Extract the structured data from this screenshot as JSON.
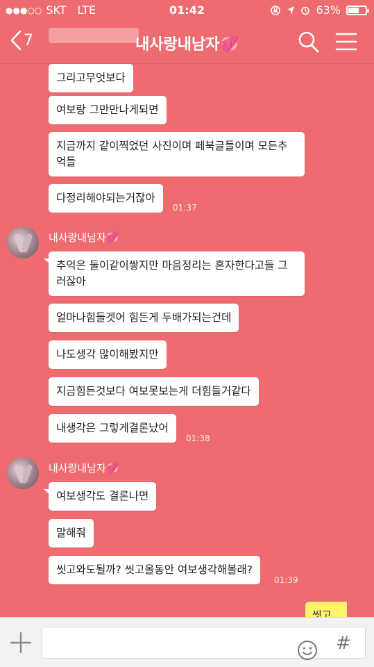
{
  "status_bar": {
    "carrier": "SKT",
    "network": "LTE",
    "time": "01:42",
    "battery_text": "63%",
    "battery_level": 0.63
  },
  "header": {
    "back_count": "7",
    "title": "내사랑내남자",
    "title_emoji": "💞",
    "search_icon": "search-icon",
    "menu_icon": "hamburger-menu-icon"
  },
  "messages": {
    "group1": {
      "bubbles": [
        "그리고무엇보다",
        "여보랑 그만만나게되면",
        "지금까지 같이찍었던 사진이며 페북글들이며 모든추억들",
        "다정리해야되는거잖아"
      ],
      "time": "01:37"
    },
    "group2": {
      "sender": "내사랑내남자",
      "sender_emoji": "💞",
      "bubbles": [
        "추억은 둘이같이쌓지만 마음정리는 혼자한다고들 그러잖아",
        "얼마나힘들겟어 힘든게 두배가되는건데",
        "나도생각 많이해봤지만",
        "지금힘든것보다 여보못보는게 더힘들거같다",
        "내생각은 그렇게결론났어"
      ],
      "time": "01:38"
    },
    "group3": {
      "sender": "내사랑내남자",
      "sender_emoji": "💞",
      "bubbles": [
        "여보생각도 결론나면",
        "말해줘",
        "씻고와도될까? 씻고올동안 여보생각해볼래?"
      ],
      "time": "01:39"
    },
    "my_partial": "씻고와"
  },
  "input_bar": {
    "placeholder": "",
    "hash_label": "#"
  }
}
